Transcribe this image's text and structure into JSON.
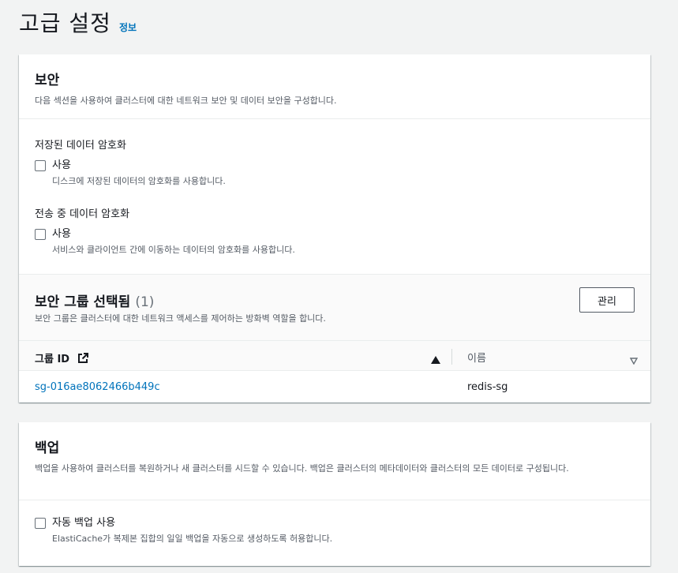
{
  "page": {
    "title": "고급 설정",
    "info_link": "정보"
  },
  "security": {
    "title": "보안",
    "description": "다음 섹션을 사용하여 클러스터에 대한 네트워크 보안 및 데이터 보안을 구성합니다.",
    "at_rest": {
      "label": "저장된 데이터 암호화",
      "checkbox_label": "사용",
      "checkbox_desc": "디스크에 저장된 데이터의 암호화를 사용합니다.",
      "checked": false
    },
    "in_transit": {
      "label": "전송 중 데이터 암호화",
      "checkbox_label": "사용",
      "checkbox_desc": "서비스와 클라이언트 간에 이동하는 데이터의 암호화를 사용합니다.",
      "checked": false
    },
    "security_groups": {
      "title": "보안 그룹 선택됨",
      "count": "(1)",
      "description": "보안 그룹은 클러스터에 대한 네트워크 액세스를 제어하는 방화벽 역할을 합니다.",
      "manage_button": "관리",
      "columns": [
        "그룹 ID",
        "이름"
      ],
      "rows": [
        {
          "id": "sg-016ae8062466b449c",
          "name": "redis-sg"
        }
      ]
    }
  },
  "backup": {
    "title": "백업",
    "description": "백업을 사용하여 클러스터를 복원하거나 새 클러스터를 시드할 수 있습니다. 백업은 클러스터의 메타데이터와 클러스터의 모든 데이터로 구성됩니다.",
    "auto_backup": {
      "checkbox_label": "자동 백업 사용",
      "checkbox_desc": "ElastiCache가 복제본 집합의 일일 백업을 자동으로 생성하도록 허용합니다.",
      "checked": false
    }
  },
  "icons": {
    "external_link": "external-link-icon",
    "sort_ascending": "sort-ascending-icon",
    "sort_descending": "sort-descending-icon"
  },
  "colors": {
    "link": "#0073bb",
    "background": "#f2f3f3",
    "text": "#16191f",
    "secondary_text": "#545b64"
  }
}
